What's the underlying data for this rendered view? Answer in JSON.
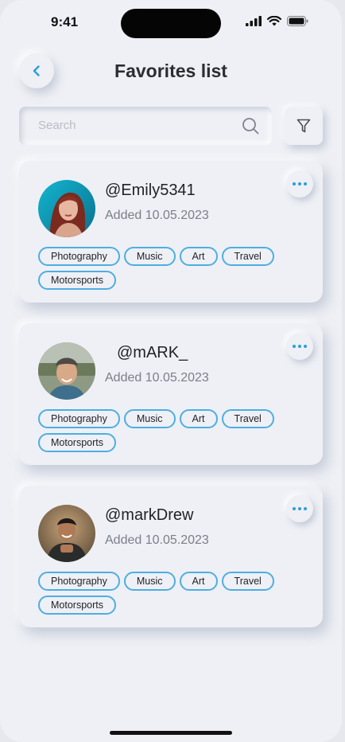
{
  "status": {
    "time": "9:41"
  },
  "header": {
    "title": "Favorites list"
  },
  "search": {
    "placeholder": "Search"
  },
  "colors": {
    "accent": "#2a9fd8",
    "tag_border": "#4eaee0",
    "background": "#eef0f5"
  },
  "favorites": [
    {
      "username": "@Emily5341",
      "added": "Added 10.05.2023",
      "tags": [
        "Photography",
        "Music",
        "Art",
        "Travel",
        "Motorsports"
      ]
    },
    {
      "username": "@mARK_",
      "added": "Added 10.05.2023",
      "tags": [
        "Photography",
        "Music",
        "Art",
        "Travel",
        "Motorsports"
      ]
    },
    {
      "username": "@markDrew",
      "added": "Added 10.05.2023",
      "tags": [
        "Photography",
        "Music",
        "Art",
        "Travel",
        "Motorsports"
      ]
    }
  ]
}
